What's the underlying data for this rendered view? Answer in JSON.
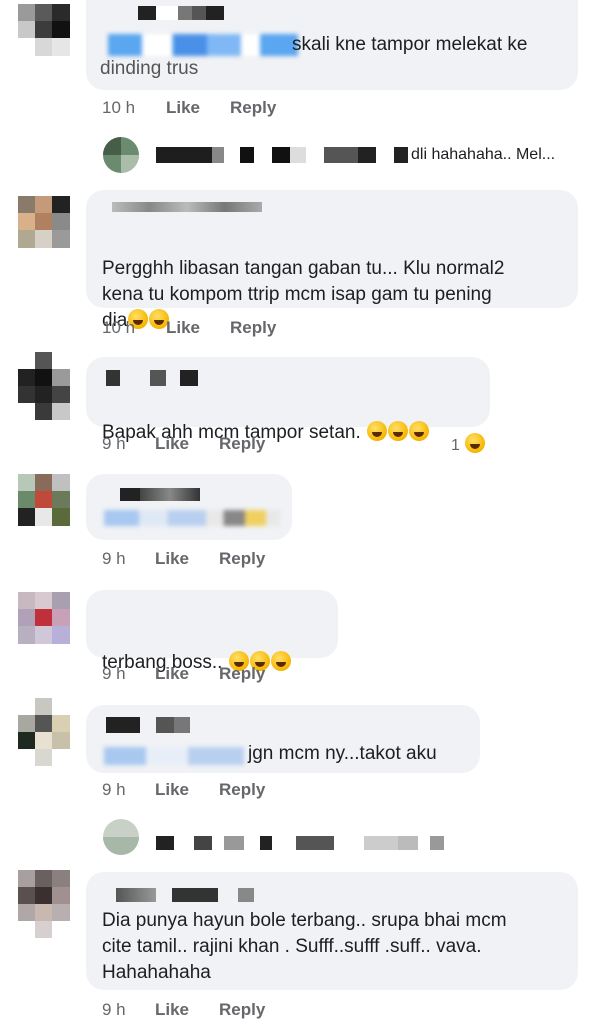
{
  "comments": [
    {
      "text_visible": "skali kne tampor melekat ke",
      "text_line2": "dinding trus",
      "time": "10 h",
      "like": "Like",
      "reply": "Reply"
    },
    {
      "reply_preview": "dli hahahaha.. Mel..."
    },
    {
      "text": "Pergghh libasan tangan gaban tu... Klu normal2\nkena tu kompom ttrip mcm isap gam tu pening\ndia",
      "time": "10 h",
      "like": "Like",
      "reply": "Reply"
    },
    {
      "text": "Bapak ahh mcm tampor setan.",
      "time": "9 h",
      "like": "Like",
      "reply": "Reply",
      "reaction_count": "1"
    },
    {
      "time": "9 h",
      "like": "Like",
      "reply": "Reply"
    },
    {
      "text": "terbang boss..",
      "time": "9 h",
      "like": "Like",
      "reply": "Reply"
    },
    {
      "text_visible": "jgn mcm ny...takot aku",
      "time": "9 h",
      "like": "Like",
      "reply": "Reply"
    },
    {
      "text": "Dia punya hayun bole terbang.. srupa bhai mcm\ncite tamil.. rajini khan . Sufff..sufff .suff.. vava.\nHahahahaha",
      "time": "9 h",
      "like": "Like",
      "reply": "Reply"
    }
  ],
  "colors": {
    "bubble": "#f0f2f5",
    "meta": "#65676b",
    "text": "#1c1e21"
  }
}
